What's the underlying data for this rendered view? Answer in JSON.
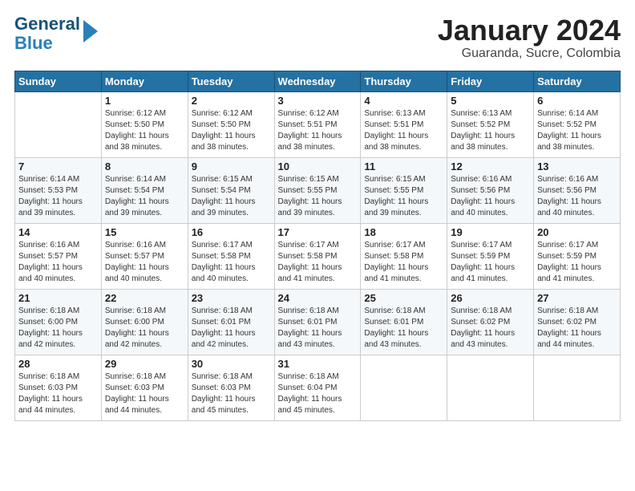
{
  "header": {
    "logo_line1": "General",
    "logo_line2": "Blue",
    "month": "January 2024",
    "location": "Guaranda, Sucre, Colombia"
  },
  "weekdays": [
    "Sunday",
    "Monday",
    "Tuesday",
    "Wednesday",
    "Thursday",
    "Friday",
    "Saturday"
  ],
  "weeks": [
    [
      {
        "day": "",
        "info": ""
      },
      {
        "day": "1",
        "info": "Sunrise: 6:12 AM\nSunset: 5:50 PM\nDaylight: 11 hours\nand 38 minutes."
      },
      {
        "day": "2",
        "info": "Sunrise: 6:12 AM\nSunset: 5:50 PM\nDaylight: 11 hours\nand 38 minutes."
      },
      {
        "day": "3",
        "info": "Sunrise: 6:12 AM\nSunset: 5:51 PM\nDaylight: 11 hours\nand 38 minutes."
      },
      {
        "day": "4",
        "info": "Sunrise: 6:13 AM\nSunset: 5:51 PM\nDaylight: 11 hours\nand 38 minutes."
      },
      {
        "day": "5",
        "info": "Sunrise: 6:13 AM\nSunset: 5:52 PM\nDaylight: 11 hours\nand 38 minutes."
      },
      {
        "day": "6",
        "info": "Sunrise: 6:14 AM\nSunset: 5:52 PM\nDaylight: 11 hours\nand 38 minutes."
      }
    ],
    [
      {
        "day": "7",
        "info": "Sunrise: 6:14 AM\nSunset: 5:53 PM\nDaylight: 11 hours\nand 39 minutes."
      },
      {
        "day": "8",
        "info": "Sunrise: 6:14 AM\nSunset: 5:54 PM\nDaylight: 11 hours\nand 39 minutes."
      },
      {
        "day": "9",
        "info": "Sunrise: 6:15 AM\nSunset: 5:54 PM\nDaylight: 11 hours\nand 39 minutes."
      },
      {
        "day": "10",
        "info": "Sunrise: 6:15 AM\nSunset: 5:55 PM\nDaylight: 11 hours\nand 39 minutes."
      },
      {
        "day": "11",
        "info": "Sunrise: 6:15 AM\nSunset: 5:55 PM\nDaylight: 11 hours\nand 39 minutes."
      },
      {
        "day": "12",
        "info": "Sunrise: 6:16 AM\nSunset: 5:56 PM\nDaylight: 11 hours\nand 40 minutes."
      },
      {
        "day": "13",
        "info": "Sunrise: 6:16 AM\nSunset: 5:56 PM\nDaylight: 11 hours\nand 40 minutes."
      }
    ],
    [
      {
        "day": "14",
        "info": "Sunrise: 6:16 AM\nSunset: 5:57 PM\nDaylight: 11 hours\nand 40 minutes."
      },
      {
        "day": "15",
        "info": "Sunrise: 6:16 AM\nSunset: 5:57 PM\nDaylight: 11 hours\nand 40 minutes."
      },
      {
        "day": "16",
        "info": "Sunrise: 6:17 AM\nSunset: 5:58 PM\nDaylight: 11 hours\nand 40 minutes."
      },
      {
        "day": "17",
        "info": "Sunrise: 6:17 AM\nSunset: 5:58 PM\nDaylight: 11 hours\nand 41 minutes."
      },
      {
        "day": "18",
        "info": "Sunrise: 6:17 AM\nSunset: 5:58 PM\nDaylight: 11 hours\nand 41 minutes."
      },
      {
        "day": "19",
        "info": "Sunrise: 6:17 AM\nSunset: 5:59 PM\nDaylight: 11 hours\nand 41 minutes."
      },
      {
        "day": "20",
        "info": "Sunrise: 6:17 AM\nSunset: 5:59 PM\nDaylight: 11 hours\nand 41 minutes."
      }
    ],
    [
      {
        "day": "21",
        "info": "Sunrise: 6:18 AM\nSunset: 6:00 PM\nDaylight: 11 hours\nand 42 minutes."
      },
      {
        "day": "22",
        "info": "Sunrise: 6:18 AM\nSunset: 6:00 PM\nDaylight: 11 hours\nand 42 minutes."
      },
      {
        "day": "23",
        "info": "Sunrise: 6:18 AM\nSunset: 6:01 PM\nDaylight: 11 hours\nand 42 minutes."
      },
      {
        "day": "24",
        "info": "Sunrise: 6:18 AM\nSunset: 6:01 PM\nDaylight: 11 hours\nand 43 minutes."
      },
      {
        "day": "25",
        "info": "Sunrise: 6:18 AM\nSunset: 6:01 PM\nDaylight: 11 hours\nand 43 minutes."
      },
      {
        "day": "26",
        "info": "Sunrise: 6:18 AM\nSunset: 6:02 PM\nDaylight: 11 hours\nand 43 minutes."
      },
      {
        "day": "27",
        "info": "Sunrise: 6:18 AM\nSunset: 6:02 PM\nDaylight: 11 hours\nand 44 minutes."
      }
    ],
    [
      {
        "day": "28",
        "info": "Sunrise: 6:18 AM\nSunset: 6:03 PM\nDaylight: 11 hours\nand 44 minutes."
      },
      {
        "day": "29",
        "info": "Sunrise: 6:18 AM\nSunset: 6:03 PM\nDaylight: 11 hours\nand 44 minutes."
      },
      {
        "day": "30",
        "info": "Sunrise: 6:18 AM\nSunset: 6:03 PM\nDaylight: 11 hours\nand 45 minutes."
      },
      {
        "day": "31",
        "info": "Sunrise: 6:18 AM\nSunset: 6:04 PM\nDaylight: 11 hours\nand 45 minutes."
      },
      {
        "day": "",
        "info": ""
      },
      {
        "day": "",
        "info": ""
      },
      {
        "day": "",
        "info": ""
      }
    ]
  ]
}
